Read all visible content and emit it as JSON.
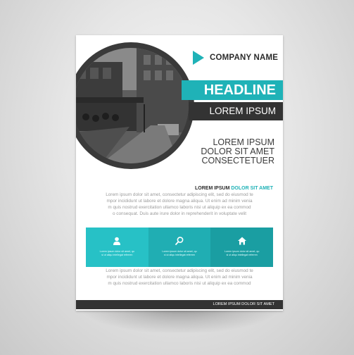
{
  "brand": {
    "name": "COMPANY NAME",
    "accent": "#1fb2b7",
    "dark": "#333333"
  },
  "hero": {
    "headline": "HEADLINE",
    "subheadline": "LOREM IPSUM",
    "tagline": [
      "LOREM IPSUM",
      "DOLOR SIT AMET",
      "CONSECTETUER"
    ]
  },
  "section": {
    "title_dark": "LOREM IPSUM",
    "title_accent": "DOLOR SIT AMET"
  },
  "paragraph_1": [
    "Lorem ipsum dolor sit amet, consectetur adipiscing elit, sed do eiusmod te",
    "mpor incididunt ut labore et dolore magna aliqua. Ut enim ad minim venia",
    "m quis nostrud exercitation ullamco laboris nisi ut aliquip ex ea commod",
    "o consequat. Duis aute irure dolor in reprehenderit in voluptate velit"
  ],
  "panels": [
    {
      "icon": "user-icon",
      "line1": "Lorem ipsum dolor sit amet, qu",
      "line2": "si ut aliqu intellegat referren"
    },
    {
      "icon": "search-icon",
      "line1": "Lorem ipsum dolor sit amet, qu",
      "line2": "si ut aliqu intellegat referren"
    },
    {
      "icon": "home-icon",
      "line1": "Lorem ipsum dolor sit amet, qu",
      "line2": "si ut aliqu intellegat referren"
    }
  ],
  "paragraph_2": [
    "Lorem ipsum dolor sit amet, consectetur adipiscing elit, sed do eiusmod te",
    "mpor incididunt ut labore et dolore magna aliqua. Ut enim ad minim venia",
    "m quis nostrud exercitation ullamco laboris nisi ut aliquip ex ea commod"
  ],
  "footer": {
    "text": "LOREM IPSUM DOLOR SIT AMET"
  }
}
